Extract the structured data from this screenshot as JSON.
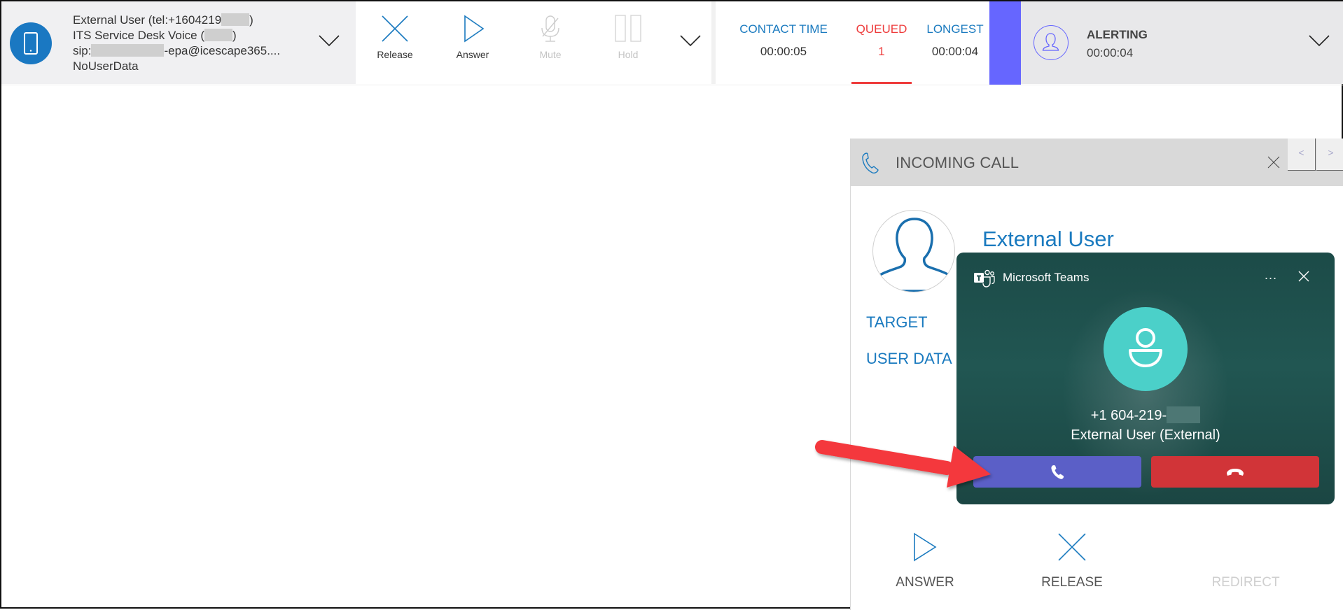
{
  "topbar": {
    "caller": {
      "line1_prefix": "External User (tel:+1604219",
      "line1_suffix": ")",
      "line2_prefix": "ITS Service Desk Voice (",
      "line2_suffix": ")",
      "line3_prefix": "sip:",
      "line3_suffix": "-epa@icescape365....",
      "line4": "NoUserData",
      "icon": "mobile-phone-icon"
    },
    "controls": [
      {
        "label": "Release",
        "icon": "x-icon",
        "enabled": true
      },
      {
        "label": "Answer",
        "icon": "play-icon",
        "enabled": true
      },
      {
        "label": "Mute",
        "icon": "mic-off-icon",
        "enabled": false
      },
      {
        "label": "Hold",
        "icon": "pause-icon",
        "enabled": false
      }
    ],
    "stats": {
      "contact_time_label": "CONTACT TIME",
      "contact_time_value": "00:00:05",
      "queued_label": "QUEUED",
      "queued_value": "1",
      "longest_label": "LONGEST",
      "longest_value": "00:00:04"
    },
    "alert": {
      "status": "ALERTING",
      "time": "00:00:04"
    }
  },
  "incoming_panel": {
    "title": "INCOMING CALL",
    "nav_prev": "<",
    "nav_next": ">",
    "contact_name": "External User",
    "target_label": "TARGET",
    "user_data_label": "USER DATA",
    "buttons": [
      {
        "label": "ANSWER",
        "enabled": true
      },
      {
        "label": "RELEASE",
        "enabled": true
      },
      {
        "label": "REDIRECT",
        "enabled": false
      }
    ]
  },
  "teams_popup": {
    "app_name": "Microsoft Teams",
    "more_label": "...",
    "phone_number": "+1 604-219-",
    "caller_label": "External User (External)"
  },
  "colors": {
    "accent_blue": "#1a7abf",
    "queued_red": "#ee3b3b",
    "alert_purple": "#6666ff",
    "teams_accept": "#5b5fc7",
    "teams_decline": "#d13438",
    "teams_avatar": "#4bd0c9",
    "annotation_arrow": "#f4373c"
  }
}
